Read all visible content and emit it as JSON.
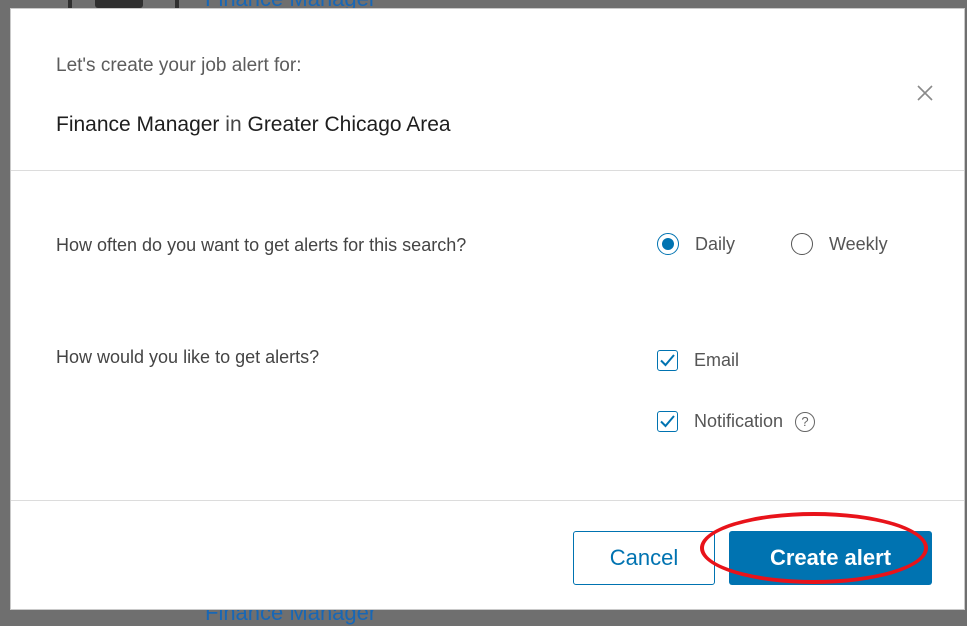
{
  "background": {
    "top_peek_text": "Finance Manager",
    "bottom_peek_text": "Finance Manager"
  },
  "dialog": {
    "subtitle": "Let's create your job alert for:",
    "title_keyword": "Finance Manager",
    "title_connector": "in",
    "title_location": "Greater Chicago Area",
    "close_icon": "close-icon",
    "frequency": {
      "question": "How often do you want to get alerts for this search?",
      "options": [
        {
          "label": "Daily",
          "selected": true
        },
        {
          "label": "Weekly",
          "selected": false
        }
      ]
    },
    "delivery": {
      "question": "How would you like to get alerts?",
      "options": [
        {
          "label": "Email",
          "checked": true
        },
        {
          "label": "Notification",
          "checked": true,
          "help_icon": "help-icon"
        }
      ]
    },
    "footer": {
      "cancel_label": "Cancel",
      "create_label": "Create alert"
    },
    "colors": {
      "accent": "#0073b1",
      "highlight": "#e8131a"
    }
  }
}
